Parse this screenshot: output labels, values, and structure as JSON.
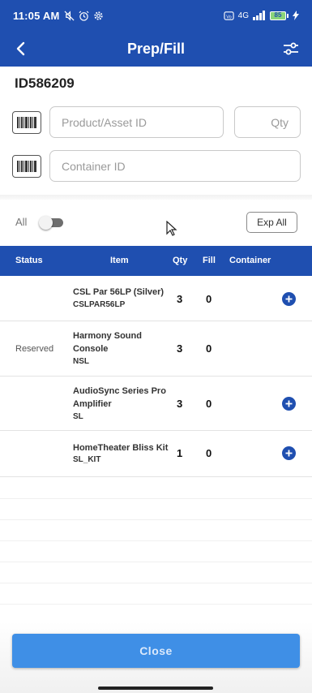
{
  "status_bar": {
    "time": "11:05 AM",
    "network": "4G",
    "battery": "85"
  },
  "app_bar": {
    "title": "Prep/Fill"
  },
  "order": {
    "id": "ID586209"
  },
  "inputs": {
    "product_placeholder": "Product/Asset ID",
    "qty_placeholder": "Qty",
    "container_placeholder": "Container ID"
  },
  "filter": {
    "all_label": "All",
    "all_toggle_on": false,
    "exp_all_label": "Exp All"
  },
  "table": {
    "columns": [
      "Status",
      "Item",
      "Qty",
      "Fill",
      "Container"
    ],
    "rows": [
      {
        "status": "",
        "name": "CSL Par 56LP (Silver)",
        "code": "CSLPAR56LP",
        "qty": "3",
        "fill": "0",
        "has_add": true
      },
      {
        "status": "Reserved",
        "name": "Harmony Sound Console",
        "code": "NSL",
        "qty": "3",
        "fill": "0",
        "has_add": false
      },
      {
        "status": "",
        "name": "AudioSync Series Pro Amplifier",
        "code": "SL",
        "qty": "3",
        "fill": "0",
        "has_add": true
      },
      {
        "status": "",
        "name": "HomeTheater Bliss Kit",
        "code": "SL_KIT",
        "qty": "1",
        "fill": "0",
        "has_add": true
      }
    ]
  },
  "footer": {
    "close_label": "Close"
  },
  "colors": {
    "primary": "#1f4fb0",
    "button": "#3f8fe6"
  }
}
